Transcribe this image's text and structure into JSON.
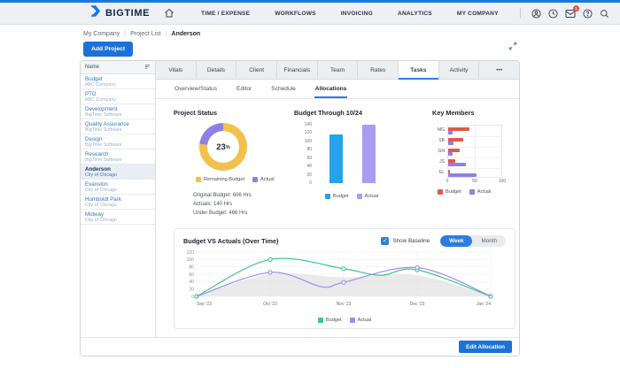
{
  "nav": {
    "brand": "BIGTIME",
    "items": [
      {
        "label": "TIME / EXPENSE"
      },
      {
        "label": "WORKFLOWS"
      },
      {
        "label": "INVOICING"
      },
      {
        "label": "ANALYTICS"
      },
      {
        "label": "MY COMPANY"
      }
    ],
    "mail_badge": "1"
  },
  "breadcrumb": {
    "items": [
      "My Company",
      "Project List",
      "Anderson"
    ]
  },
  "actions": {
    "add_project": "Add Project",
    "edit_allocation": "Edit Allocation"
  },
  "sidebar": {
    "header": "Name",
    "items": [
      {
        "name": "Budget",
        "company": "ABC Company"
      },
      {
        "name": "PTO",
        "company": "ABC Company"
      },
      {
        "name": "Development",
        "company": "BigTime Software"
      },
      {
        "name": "Quality Assurance",
        "company": "BigTime Software"
      },
      {
        "name": "Design",
        "company": "BigTime Software"
      },
      {
        "name": "Research",
        "company": "BigTime Software"
      },
      {
        "name": "Anderson",
        "company": "City of Chicago",
        "selected": true
      },
      {
        "name": "Evanston",
        "company": "City of Chicago"
      },
      {
        "name": "Humboldt Park",
        "company": "City of Chicago"
      },
      {
        "name": "Midway",
        "company": "City of Chicago"
      }
    ]
  },
  "tabs": {
    "items": [
      {
        "label": "Vitals"
      },
      {
        "label": "Details"
      },
      {
        "label": "Client"
      },
      {
        "label": "Financials"
      },
      {
        "label": "Team"
      },
      {
        "label": "Rates"
      },
      {
        "label": "Tasks",
        "active": true
      },
      {
        "label": "Activity"
      },
      {
        "label": "•••"
      }
    ]
  },
  "subtabs": {
    "items": [
      {
        "label": "Overview/Status"
      },
      {
        "label": "Editor"
      },
      {
        "label": "Schedule"
      },
      {
        "label": "Allocations",
        "active": true
      }
    ]
  },
  "project_status": {
    "title": "Project Status",
    "center_value": "23",
    "center_suffix": "%",
    "stats": [
      "Original Budget: 606 Hrs",
      "Actuals: 140 Hrs",
      "Under Budget: 466 Hrs"
    ]
  },
  "timeline_controls": {
    "show_baseline": "Show Baseline",
    "week": "Week",
    "month": "Month"
  },
  "chart_data": [
    {
      "id": "status_donut",
      "type": "pie",
      "title": "Project Status",
      "center_label": "23%",
      "slices": [
        {
          "label": "Remaining Budget",
          "value": 77,
          "color": "#f2c14d"
        },
        {
          "label": "Actual",
          "value": 23,
          "color": "#8f80e8"
        }
      ],
      "legend_position": "bottom"
    },
    {
      "id": "budget_through",
      "type": "bar",
      "title": "Budget Through 10/24",
      "categories": [
        "Budget",
        "Actual"
      ],
      "values": [
        117,
        139
      ],
      "colors": [
        "#25a2e8",
        "#aa9cef"
      ],
      "ylim": [
        0,
        140
      ],
      "yticks": [
        0,
        20,
        40,
        60,
        80,
        100,
        120,
        140
      ],
      "legend": [
        "Budget",
        "Actual"
      ],
      "legend_position": "bottom"
    },
    {
      "id": "key_members",
      "type": "bar-horizontal",
      "title": "Key Members",
      "categories": [
        "MG",
        "SB",
        "GN",
        "JS",
        "EL"
      ],
      "series": [
        {
          "name": "Budget",
          "color": "#e2574d",
          "values": [
            40,
            28,
            22,
            13,
            3
          ]
        },
        {
          "name": "Actual",
          "color": "#8f80e8",
          "values": [
            8,
            10,
            8,
            34,
            54
          ]
        }
      ],
      "xlim": [
        0,
        100
      ],
      "xticks": [
        0,
        50,
        100
      ],
      "grid": true,
      "legend_position": "bottom"
    },
    {
      "id": "budget_vs_actuals",
      "type": "line",
      "title": "Budget VS Actuals (Over Time)",
      "x_categories": [
        "Sep '23",
        "Oct '23",
        "Nov '23",
        "Dec '23",
        "Jan '24"
      ],
      "ylim": [
        0,
        120
      ],
      "yticks": [
        0,
        20,
        40,
        60,
        80,
        100,
        120
      ],
      "grid": true,
      "series": [
        {
          "name": "Budget",
          "color": "#3dc78a",
          "points": [
            [
              0,
              0
            ],
            [
              1,
              100
            ],
            [
              2,
              75
            ],
            [
              2.5,
              57
            ],
            [
              3,
              72
            ],
            [
              4,
              0
            ]
          ],
          "markers": [
            0,
            1,
            2,
            3,
            4
          ]
        },
        {
          "name": "Actual",
          "color": "#9b8ef0",
          "points": [
            [
              0,
              0
            ],
            [
              1,
              65
            ],
            [
              1.7,
              26
            ],
            [
              2,
              38
            ],
            [
              3,
              78
            ],
            [
              4,
              1
            ]
          ],
          "markers": [
            1,
            2,
            3
          ]
        }
      ],
      "baseline": {
        "name": "Baseline",
        "color": "#d9d9d9",
        "points": [
          [
            0,
            0
          ],
          [
            1,
            60
          ],
          [
            2,
            52
          ],
          [
            3,
            57
          ],
          [
            4,
            0
          ]
        ]
      },
      "legend": [
        "Budget",
        "Actual"
      ],
      "legend_position": "bottom"
    }
  ]
}
